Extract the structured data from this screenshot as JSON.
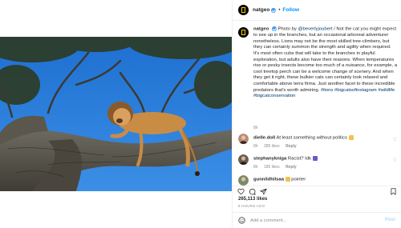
{
  "post": {
    "username": "natgeo",
    "follow_label": "Follow",
    "separator": "•",
    "photo_alt": "Lion resting on a tree branch",
    "caption": {
      "credit": "Photo by",
      "photographer": "@beverlyjoubert",
      "body": " / Not the cat you might expect to see up in the branches, but an occasional arboreal adventurer nonetheless. Lions may not be the most skilled tree-climbers, but they can certainly summon the strength and agility when required. It's most often cubs that will take to the branches in playful exploration, but adults also have their reasons. When temperatures rise or pesky insects become too much of a nuisance, for example, a cool treetop perch can be a welcome change of scenery. And when they get it right, these bulkier cats can certainly look relaxed and comfortable above terra firma. Just another facet to these incredible predators that's worth admiring. ",
      "tags": "#lions #bigcatsofinstagram #wildlife #bigcatconservation",
      "age": "8h"
    },
    "comments": [
      {
        "username": "dielle.doll",
        "text": "At least something without politics",
        "age": "8h",
        "likes": "285 likes",
        "reply": "Reply"
      },
      {
        "username": "stephanykniga",
        "text": "Racist? Idk",
        "age": "8h",
        "likes": "185 likes",
        "reply": "Reply"
      },
      {
        "username": "gunnildhilsaa",
        "text": "pointer",
        "age": "",
        "likes": "",
        "reply": ""
      }
    ],
    "likes_count": "265,113 likes",
    "time_ago": "8 HOURS AGO",
    "add_comment_placeholder": "Add a comment...",
    "post_label": "Post"
  },
  "colors": {
    "link_blue": "#0095f6",
    "tag_blue": "#00376b",
    "muted": "#8e8e8e",
    "verified": "#3897f0",
    "natgeo_yellow": "#ffcc00"
  },
  "icons": [
    "heart-icon",
    "comment-icon",
    "share-icon",
    "bookmark-icon",
    "emoji-icon",
    "verified-icon",
    "natgeo-logo"
  ]
}
